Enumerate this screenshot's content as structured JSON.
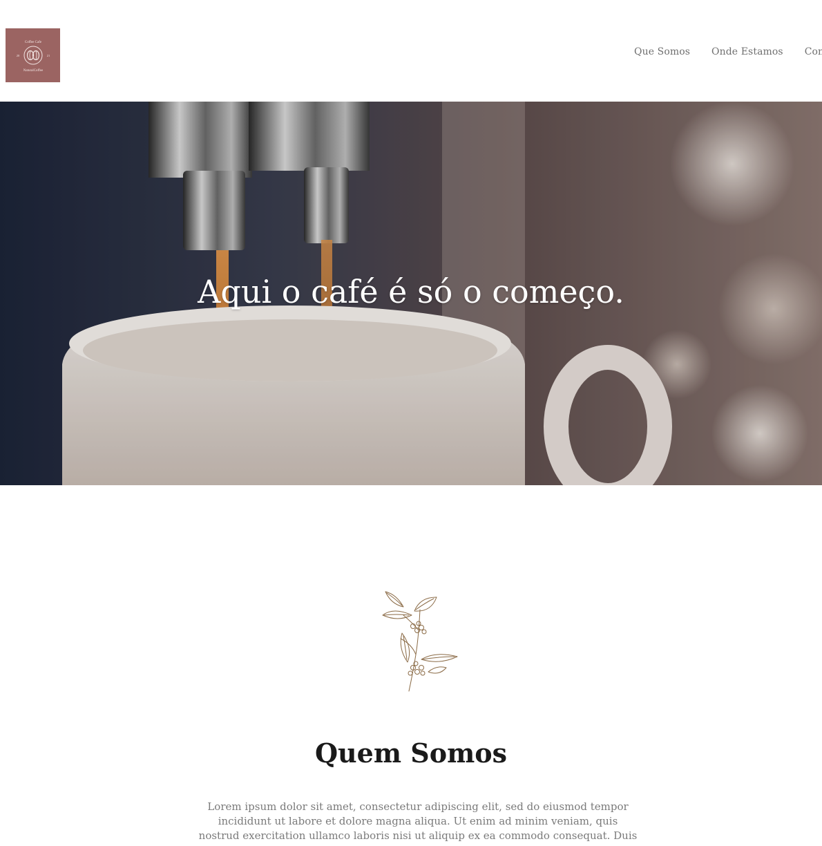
{
  "header": {
    "logo": {
      "brand_top": "Coffee Cafe",
      "brand_bottom": "NaturalCoffee",
      "year_left": "20",
      "year_right": "21"
    },
    "nav": [
      {
        "label": "Que Somos"
      },
      {
        "label": "Onde Estamos"
      },
      {
        "label": "Contat"
      }
    ]
  },
  "hero": {
    "title": "Aqui o café é só o começo."
  },
  "about": {
    "title": "Quem Somos",
    "text": "Lorem ipsum dolor sit amet, consectetur adipiscing elit, sed do eiusmod tempor incididunt ut labore et dolore magna aliqua. Ut enim ad minim veniam, quis nostrud exercitation ullamco laboris nisi ut aliquip ex ea commodo consequat. Duis aute"
  },
  "colors": {
    "logo_bg": "#9b6462",
    "nav_text": "#6f6f6f",
    "branch_line": "#8a6a45",
    "body_text": "#7a7a7a"
  },
  "icons": {
    "logo_icon": "coffee-bean-icon",
    "branch_icon": "coffee-branch-illustration"
  }
}
